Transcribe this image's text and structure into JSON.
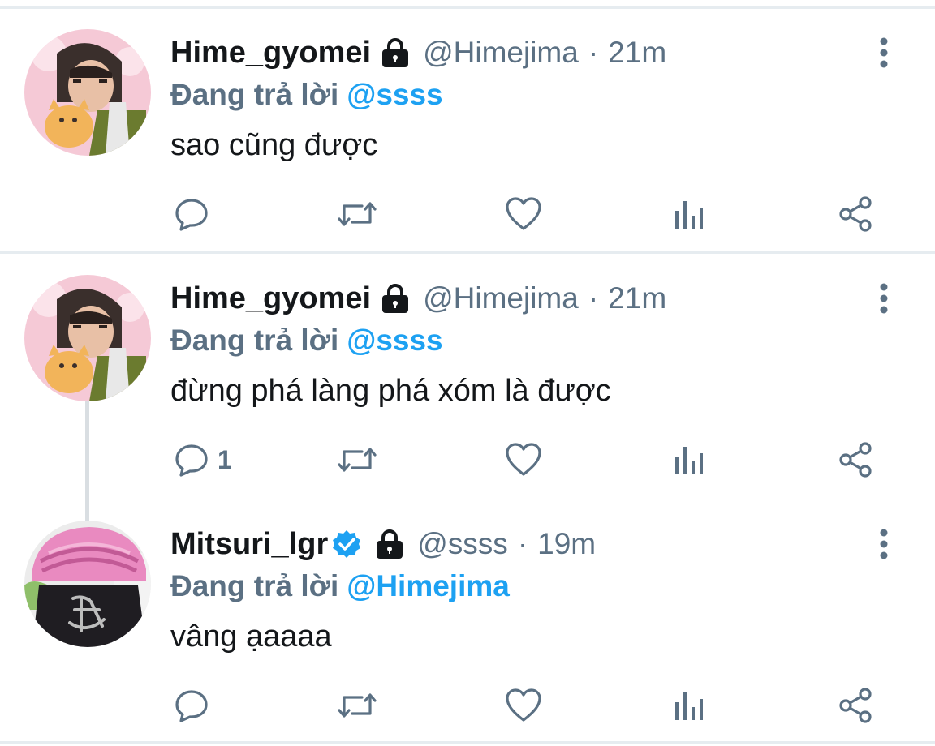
{
  "tweets": [
    {
      "display_name": "Hime_gyomei",
      "handle": "@Himejima",
      "separator": "·",
      "time": "21m",
      "reply_prefix": "Đang trả lời",
      "reply_to": "@ssss",
      "text": "sao cũng được",
      "reply_count": "",
      "verified": false,
      "protected": true,
      "avatar": "pink-haired-character-holding-cat-avatar"
    },
    {
      "display_name": "Hime_gyomei",
      "handle": "@Himejima",
      "separator": "·",
      "time": "21m",
      "reply_prefix": "Đang trả lời",
      "reply_to": "@ssss",
      "text": "đừng phá làng phá xóm là được",
      "reply_count": "1",
      "verified": false,
      "protected": true,
      "avatar": "pink-haired-character-holding-cat-avatar"
    },
    {
      "display_name": "Mitsuri_lgr",
      "handle": "@ssss",
      "separator": "·",
      "time": "19m",
      "reply_prefix": "Đang trả lời",
      "reply_to": "@Himejima",
      "text": "vâng ạaaaa",
      "reply_count": "",
      "verified": true,
      "protected": true,
      "avatar": "pink-braided-hair-character-avatar"
    }
  ],
  "icons": {
    "lock": "lock-icon",
    "verified": "verified-badge-icon",
    "more": "more-vertical-icon",
    "reply": "reply-icon",
    "retweet": "retweet-icon",
    "like": "like-icon",
    "analytics": "analytics-icon",
    "share": "share-icon"
  },
  "colors": {
    "text_primary": "#14171a",
    "text_secondary": "#5b7083",
    "link": "#1da1f2",
    "verified": "#1da1f2",
    "divider": "#e6ecf0",
    "thread_line": "#d9dee2"
  }
}
